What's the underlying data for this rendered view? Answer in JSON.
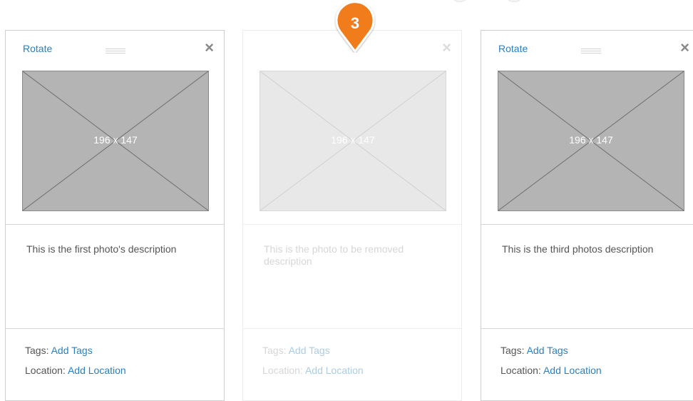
{
  "cards": [
    {
      "rotate_label": "Rotate",
      "close_label": "×",
      "image_dimensions": "196 x 147",
      "description": "This is the first photo's description",
      "tags_label": "Tags:",
      "tags_link": "Add Tags",
      "location_label": "Location:",
      "location_link": "Add Location"
    },
    {
      "close_label": "×",
      "image_dimensions": "196 x 147",
      "description": "This is the photo to be removed description",
      "tags_label": "Tags:",
      "tags_link": "Add Tags",
      "location_label": "Location:",
      "location_link": "Add Location"
    },
    {
      "rotate_label": "Rotate",
      "close_label": "×",
      "image_dimensions": "196 x 147",
      "description": "This is the third photos description",
      "tags_label": "Tags:",
      "tags_link": "Add Tags",
      "location_label": "Location:",
      "location_link": "Add Location"
    }
  ],
  "step_marker": {
    "number": "3",
    "color": "#f07c1b"
  },
  "colors": {
    "link": "#2a7fc1",
    "placeholder_bg": "#b4b4b4",
    "faded_placeholder_bg": "#e8e8e8"
  }
}
